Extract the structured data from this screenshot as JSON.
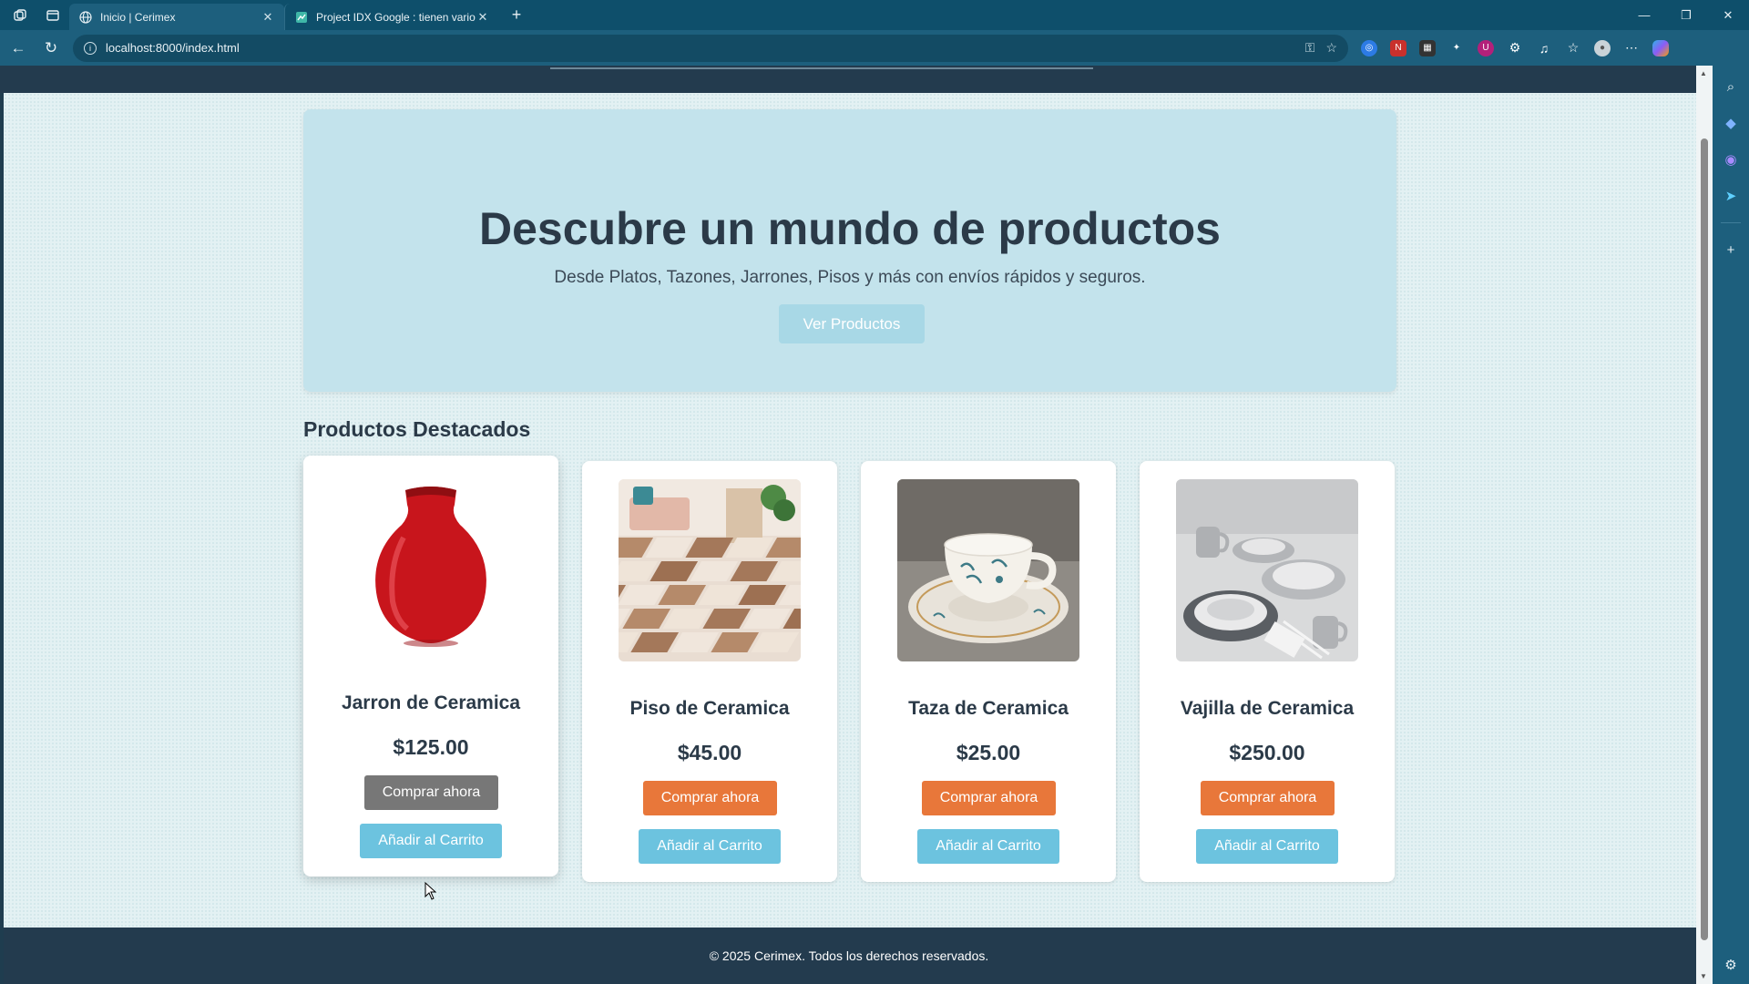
{
  "browser": {
    "tabs": [
      {
        "title": "Inicio | Cerimex",
        "active": true
      },
      {
        "title": "Project IDX Google : tienen vario:",
        "active": false
      }
    ],
    "url": "localhost:8000/index.html",
    "accent": "#0e4f6b"
  },
  "hero": {
    "title": "Descubre un mundo de productos",
    "subtitle": "Desde Platos, Tazones, Jarrones, Pisos y más con envíos rápidos y seguros.",
    "button": "Ver Productos"
  },
  "featured": {
    "title": "Productos Destacados",
    "products": [
      {
        "name": "Jarron de Ceramica",
        "price": "$125.00",
        "buy": "Comprar ahora",
        "cart": "Añadir al Carrito",
        "image_icon": "vase-image"
      },
      {
        "name": "Piso de Ceramica",
        "price": "$45.00",
        "buy": "Comprar ahora",
        "cart": "Añadir al Carrito",
        "image_icon": "floor-image"
      },
      {
        "name": "Taza de Ceramica",
        "price": "$25.00",
        "buy": "Comprar ahora",
        "cart": "Añadir al Carrito",
        "image_icon": "cup-image"
      },
      {
        "name": "Vajilla de Ceramica",
        "price": "$250.00",
        "buy": "Comprar ahora",
        "cart": "Añadir al Carrito",
        "image_icon": "dishes-image"
      }
    ]
  },
  "footer": {
    "text": "© 2025 Cerimex. Todos los derechos reservados."
  },
  "colors": {
    "buy_button": "#e8773a",
    "cart_button": "#6cc3df",
    "hero_bg": "#c3e3ec",
    "text_dark": "#2b3a48"
  }
}
